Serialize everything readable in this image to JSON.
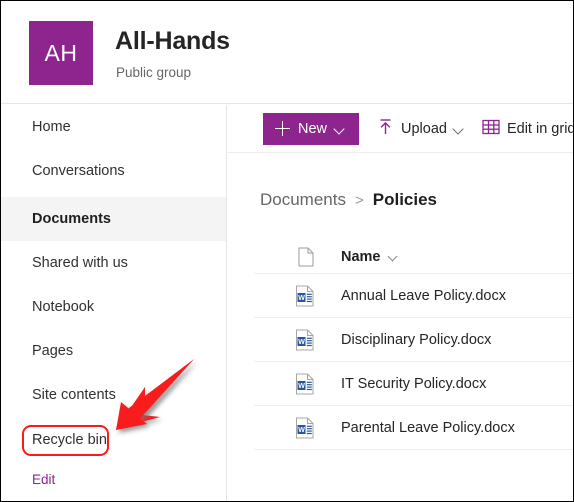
{
  "site": {
    "avatar_initials": "AH",
    "avatar_color": "#8e258e",
    "title": "All-Hands",
    "subtitle": "Public group"
  },
  "sidebar": {
    "items": [
      {
        "label": "Home",
        "selected": false
      },
      {
        "label": "Conversations",
        "selected": false
      },
      {
        "label": "Documents",
        "selected": true
      },
      {
        "label": "Shared with us",
        "selected": false
      },
      {
        "label": "Notebook",
        "selected": false
      },
      {
        "label": "Pages",
        "selected": false
      },
      {
        "label": "Site contents",
        "selected": false
      },
      {
        "label": "Recycle bin",
        "selected": false
      }
    ],
    "edit_label": "Edit",
    "edit_color": "#8e258e"
  },
  "command_bar": {
    "new_label": "New",
    "new_icon": "plus-icon",
    "new_chevron": "chevron-down-icon",
    "upload_label": "Upload",
    "upload_icon": "upload-icon",
    "upload_chevron": "chevron-down-icon",
    "edit_grid_label": "Edit in grid",
    "edit_grid_icon": "grid-icon",
    "accent_color": "#8e258e"
  },
  "breadcrumb": {
    "root": "Documents",
    "separator": ">",
    "current": "Policies"
  },
  "file_list": {
    "columns": [
      {
        "label": "Name",
        "icon": "document-outline-icon",
        "sort_chevron": "chevron-down-icon"
      }
    ],
    "rows": [
      {
        "name": "Annual Leave Policy.docx",
        "icon": "word-file-icon"
      },
      {
        "name": "Disciplinary Policy.docx",
        "icon": "word-file-icon"
      },
      {
        "name": "IT Security Policy.docx",
        "icon": "word-file-icon"
      },
      {
        "name": "Parental Leave Policy.docx",
        "icon": "word-file-icon"
      }
    ]
  },
  "annotations": {
    "arrow": {
      "icon": "red-arrow-annotation",
      "color": "#f91b1b",
      "points_to": "Recycle bin"
    },
    "highlight_box": {
      "icon": "red-rounded-rect-annotation",
      "color": "#f91b1b",
      "around": "Recycle bin"
    }
  }
}
